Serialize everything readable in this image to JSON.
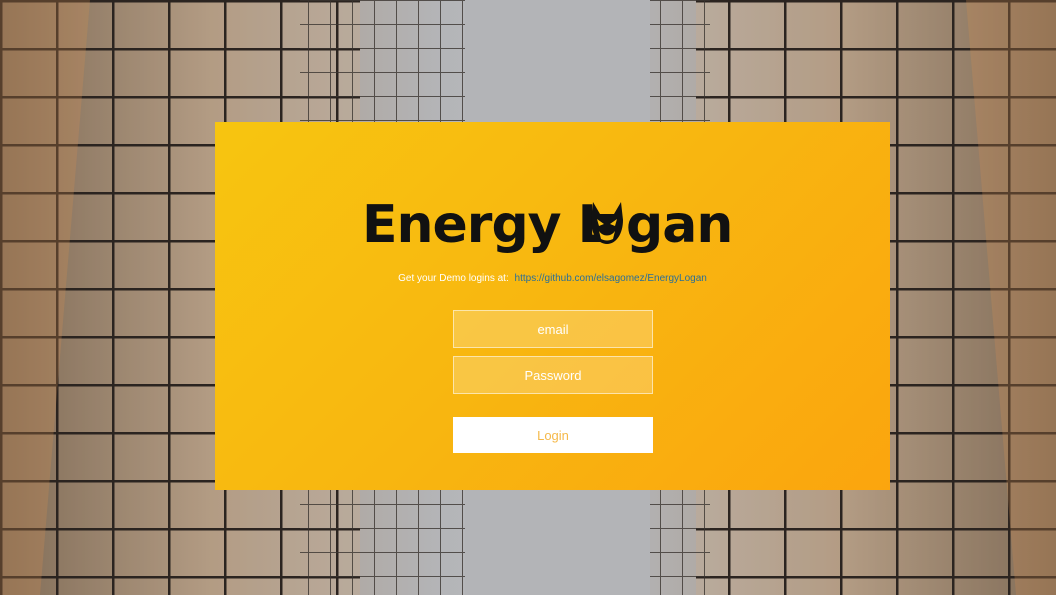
{
  "app": {
    "logo_text_before": "Energy L",
    "logo_text_after": "gan",
    "logo_icon": "mascot-head-icon"
  },
  "notice": {
    "prefix": "Get your Demo logins at:",
    "link_text": "https://github.com/elsagomez/EnergyLogan"
  },
  "form": {
    "email_placeholder": "email",
    "password_placeholder": "Password",
    "login_label": "Login"
  },
  "colors": {
    "card_gradient_start": "#f7c510",
    "card_gradient_end": "#fba50e",
    "link": "#2a6f97",
    "button_text": "#f5b94a"
  }
}
